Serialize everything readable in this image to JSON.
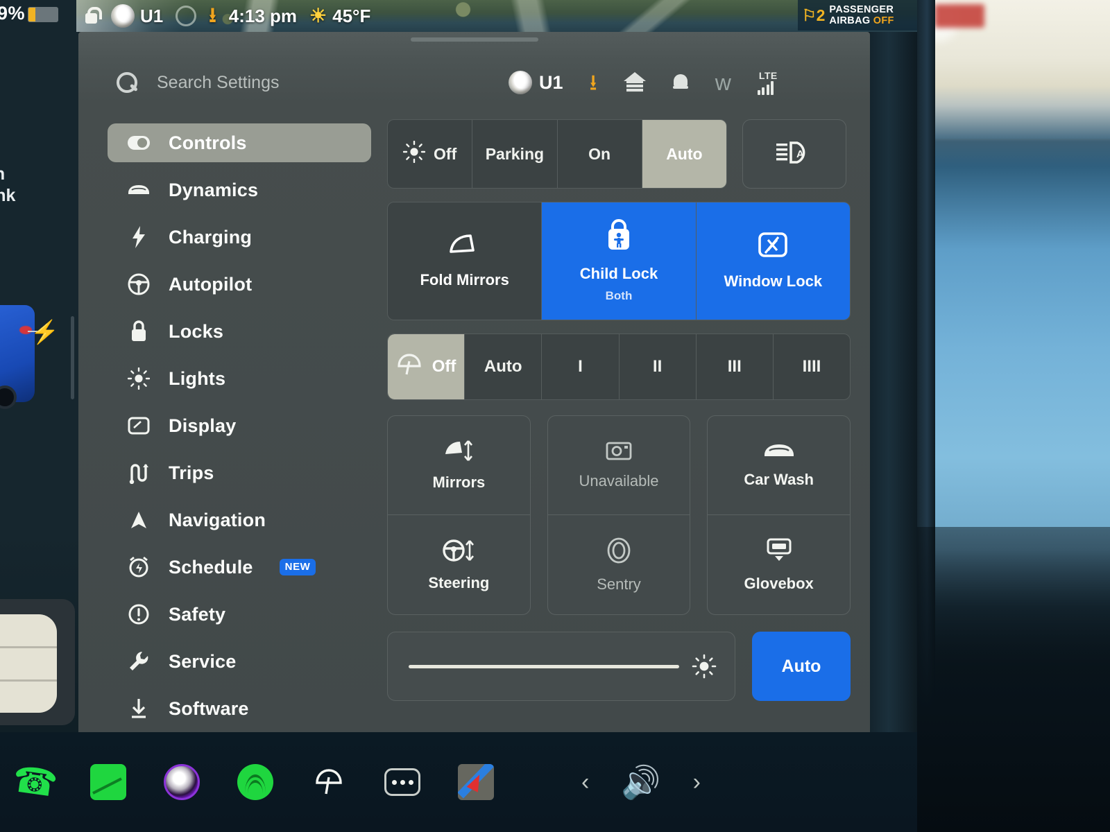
{
  "status_bar": {
    "lock_icon": "lock-icon",
    "profile_icon": "profile-ring-icon",
    "driver_avatar": "driver-avatar",
    "driver_name": "U1",
    "download_icon": "download-icon",
    "time": "4:13 pm",
    "weather_icon": "sun-icon",
    "temperature": "45°F",
    "airbag": {
      "icon": "passenger-airbag-icon",
      "line1": "PASSENGER",
      "line2": "AIRBAG",
      "state": "OFF"
    }
  },
  "left_overlay": {
    "battery_percent": "9%",
    "open_trunk_line1": "en",
    "open_trunk_line2": "unk",
    "charge_bolt_icon": "charge-bolt-icon"
  },
  "panel_header": {
    "search": {
      "icon": "search-icon",
      "placeholder": "Search Settings",
      "value": ""
    },
    "driver_name": "U1",
    "icons": [
      {
        "name": "download-icon",
        "label": "Software Download"
      },
      {
        "name": "garage-icon",
        "label": "Garage"
      },
      {
        "name": "bell-icon",
        "label": "Notifications"
      },
      {
        "name": "bluetooth-icon",
        "label": "Bluetooth"
      }
    ],
    "signal": {
      "network": "LTE",
      "bars": 4
    }
  },
  "sidebar": {
    "items": [
      {
        "label": "Controls",
        "icon": "toggle-icon",
        "active": true
      },
      {
        "label": "Dynamics",
        "icon": "car-icon",
        "active": false
      },
      {
        "label": "Charging",
        "icon": "bolt-icon",
        "active": false
      },
      {
        "label": "Autopilot",
        "icon": "steering-wheel-icon",
        "active": false
      },
      {
        "label": "Locks",
        "icon": "lock-icon",
        "active": false
      },
      {
        "label": "Lights",
        "icon": "sun-icon",
        "active": false
      },
      {
        "label": "Display",
        "icon": "display-icon",
        "active": false
      },
      {
        "label": "Trips",
        "icon": "trips-icon",
        "active": false
      },
      {
        "label": "Navigation",
        "icon": "navigation-arrow-icon",
        "active": false
      },
      {
        "label": "Schedule",
        "icon": "alarm-clock-icon",
        "active": false,
        "badge": "NEW"
      },
      {
        "label": "Safety",
        "icon": "alert-circle-icon",
        "active": false
      },
      {
        "label": "Service",
        "icon": "wrench-icon",
        "active": false
      },
      {
        "label": "Software",
        "icon": "download-icon",
        "active": false
      }
    ]
  },
  "controls": {
    "lights_segment": {
      "icon": "headlight-sun-icon",
      "options": [
        "Off",
        "Parking",
        "On",
        "Auto"
      ],
      "selected": "Auto"
    },
    "auto_high_beam": {
      "icon": "auto-high-beam-icon"
    },
    "tiles": [
      {
        "label": "Fold Mirrors",
        "icon": "mirror-icon",
        "sublabel": "",
        "active": false
      },
      {
        "label": "Child Lock",
        "icon": "child-lock-icon",
        "sublabel": "Both",
        "active": true
      },
      {
        "label": "Window Lock",
        "icon": "window-lock-icon",
        "sublabel": "",
        "active": true
      }
    ],
    "wipers_segment": {
      "icon": "wiper-icon",
      "options": [
        "Off",
        "Auto",
        "I",
        "II",
        "III",
        "IIII"
      ],
      "selected": "Off"
    },
    "grid": [
      {
        "label": "Mirrors",
        "icon": "mirror-adjust-icon",
        "dim": false
      },
      {
        "label": "Steering",
        "icon": "steering-adjust-icon",
        "dim": false
      },
      {
        "label": "Unavailable",
        "icon": "camera-icon",
        "dim": true
      },
      {
        "label": "Sentry",
        "icon": "sentry-icon",
        "dim": true
      },
      {
        "label": "Car Wash",
        "icon": "car-wash-icon",
        "dim": false
      },
      {
        "label": "Glovebox",
        "icon": "glovebox-icon",
        "dim": false
      }
    ],
    "brightness": {
      "icon": "brightness-icon",
      "value_percent": 98,
      "auto_label": "Auto",
      "auto_active": true
    }
  },
  "dock": {
    "apps": [
      {
        "name": "phone-app-icon",
        "label": "Phone"
      },
      {
        "name": "energy-app-icon",
        "label": "Energy"
      },
      {
        "name": "voice-app-icon",
        "label": "Voice"
      },
      {
        "name": "spotify-app-icon",
        "label": "Spotify"
      },
      {
        "name": "wiper-app-icon",
        "label": "Wipers"
      },
      {
        "name": "more-app-icon",
        "label": "More"
      },
      {
        "name": "maps-app-icon",
        "label": "Maps"
      }
    ],
    "media": {
      "prev_icon": "chevron-left-icon",
      "volume_icon": "volume-icon",
      "next_icon": "chevron-right-icon"
    }
  },
  "colors": {
    "accent_blue": "#1a6ee8",
    "selected_grey": "#b4b6a8",
    "panel_bg": "#464d4d",
    "amber": "#f0a51e"
  }
}
